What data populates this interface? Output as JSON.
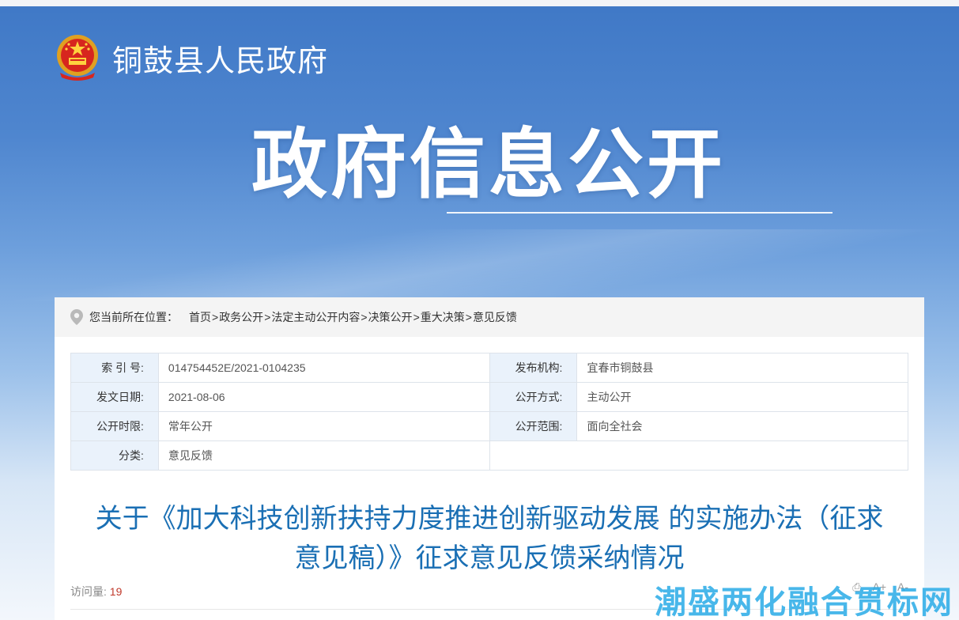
{
  "site": {
    "name": "铜鼓县人民政府"
  },
  "banner": {
    "title": "政府信息公开"
  },
  "location": {
    "label": "您当前所在位置：",
    "crumbs": [
      "首页",
      "政务公开",
      "法定主动公开内容",
      "决策公开",
      "重大决策",
      "意见反馈"
    ],
    "separator": ">"
  },
  "meta": {
    "index_key": "索 引 号:",
    "index_val": "014754452E/2021-0104235",
    "publisher_key": "发布机构:",
    "publisher_val": "宜春市铜鼓县",
    "date_key": "发文日期:",
    "date_val": "2021-08-06",
    "mode_key": "公开方式:",
    "mode_val": "主动公开",
    "period_key": "公开时限:",
    "period_val": "常年公开",
    "scope_key": "公开范围:",
    "scope_val": "面向全社会",
    "category_key": "分类:",
    "category_val": "意见反馈"
  },
  "article": {
    "title_line1": "关于《加大科技创新扶持力度推进创新驱动发展 的实施办法（征求",
    "title_line2": "意见稿）》征求意见反馈采纳情况"
  },
  "stats": {
    "visits_label": "访问量:",
    "visits_value": "19"
  },
  "tools": {
    "print": "⎙",
    "font_larger": "A+",
    "font_smaller": "A-"
  },
  "watermark": {
    "text": "潮盛两化融合贯标网"
  },
  "colors": {
    "title_blue": "#1a6fb4",
    "visits_red": "#c0392b"
  }
}
